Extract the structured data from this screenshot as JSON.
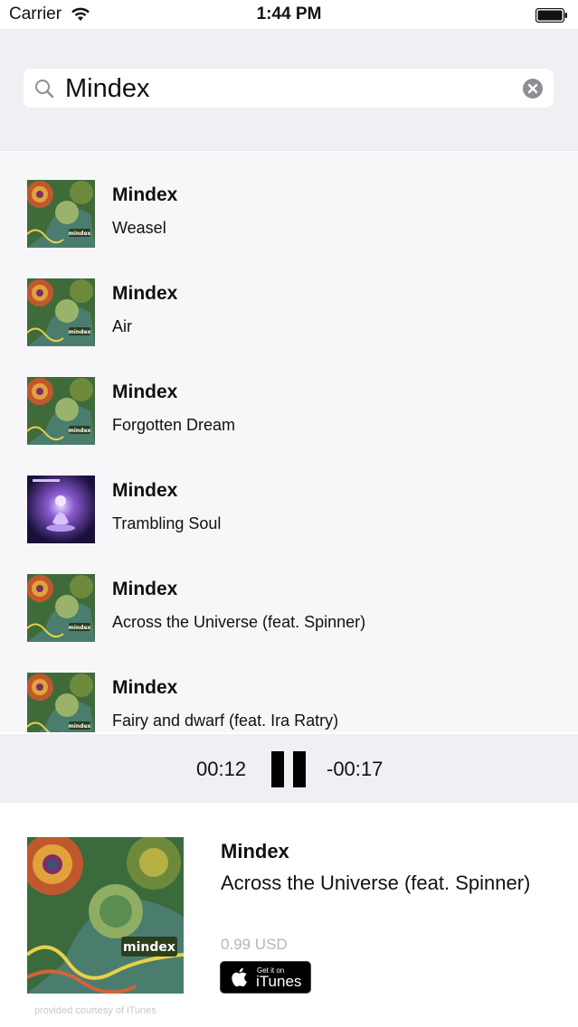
{
  "status_bar": {
    "carrier": "Carrier",
    "time": "1:44 PM"
  },
  "search": {
    "value": "Mindex"
  },
  "results": [
    {
      "artist": "Mindex",
      "title": "Weasel",
      "artwork": "mindex-cover"
    },
    {
      "artist": "Mindex",
      "title": "Air",
      "artwork": "mindex-cover"
    },
    {
      "artist": "Mindex",
      "title": "Forgotten Dream",
      "artwork": "mindex-cover"
    },
    {
      "artist": "Mindex",
      "title": "Trambling Soul",
      "artwork": "meditation-cover"
    },
    {
      "artist": "Mindex",
      "title": "Across the Universe (feat. Spinner)",
      "artwork": "mindex-cover"
    },
    {
      "artist": "Mindex",
      "title": "Fairy and dwarf (feat. Ira Ratry)",
      "artwork": "mindex-cover"
    }
  ],
  "player": {
    "elapsed": "00:12",
    "remaining": "-00:17",
    "icon": "pause-icon"
  },
  "now_playing": {
    "artist": "Mindex",
    "title": "Across the Universe (feat. Spinner)",
    "price": "0.99 USD",
    "badge_small": "Get it on",
    "badge_big": "iTunes",
    "courtesy": "provided courtesy of iTunes",
    "cover_label": "mindex"
  },
  "colors": {
    "bar_gray": "#efeff4",
    "list_bg": "#f7f7f9",
    "price_gray": "#b6b6b6"
  }
}
